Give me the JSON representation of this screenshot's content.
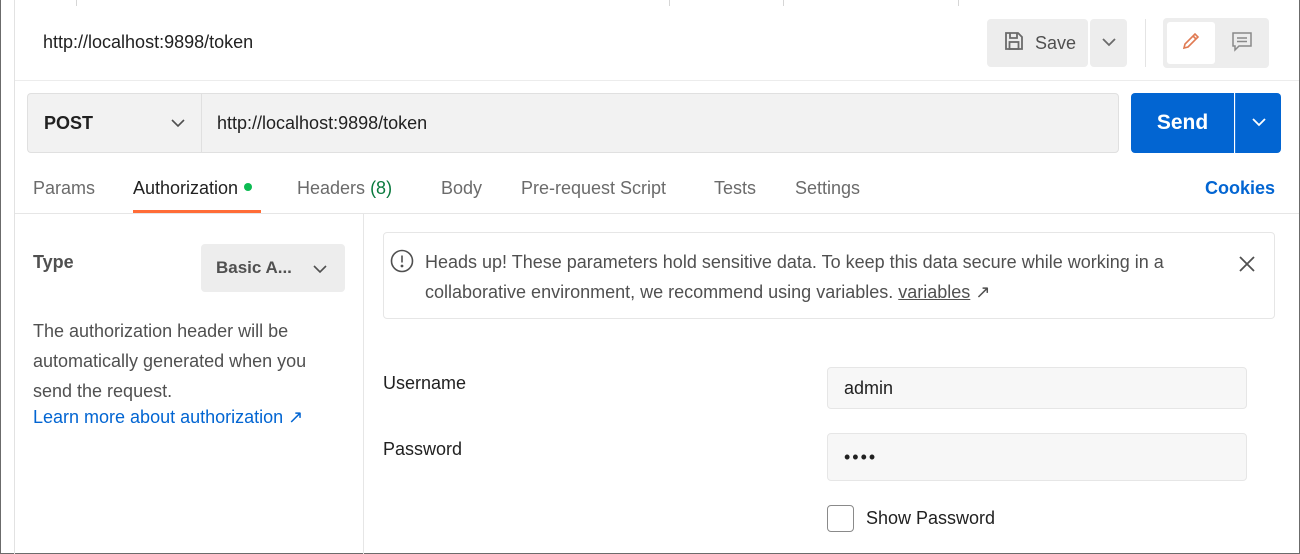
{
  "request_title": "http://localhost:9898/token",
  "toolbar": {
    "save_label": "Save",
    "save_icon": "floppy-disk-icon",
    "save_menu_icon": "chevron-down-icon",
    "edit_mode_icon": "pencil-icon",
    "comment_mode_icon": "comment-icon"
  },
  "request": {
    "method": "POST",
    "url": "http://localhost:9898/token",
    "send_label": "Send"
  },
  "tabs": [
    {
      "label": "Params"
    },
    {
      "label": "Authorization",
      "active": true,
      "indicator": "green-dot"
    },
    {
      "label": "Headers",
      "count": "(8)"
    },
    {
      "label": "Body"
    },
    {
      "label": "Pre-request Script"
    },
    {
      "label": "Tests"
    },
    {
      "label": "Settings"
    }
  ],
  "cookies_label": "Cookies",
  "auth": {
    "type_label": "Type",
    "type_value": "Basic A...",
    "description": "The authorization header will be automatically generated when you send the request.",
    "learn_more": "Learn more about authorization ↗"
  },
  "warning": {
    "text": "Heads up! These parameters hold sensitive data. To keep this data secure while working in a collaborative environment, we recommend using variables.",
    "link": "variables",
    "link_arrow": "↗"
  },
  "fields": {
    "username_label": "Username",
    "username_value": "admin",
    "password_label": "Password",
    "password_value": "••••",
    "show_password_label": "Show Password"
  },
  "colors": {
    "accent": "#ff6c37",
    "send": "#0265d2",
    "link": "#0265d2",
    "status_dot": "#0cbb52",
    "headers_count": "#0a7a3e"
  }
}
